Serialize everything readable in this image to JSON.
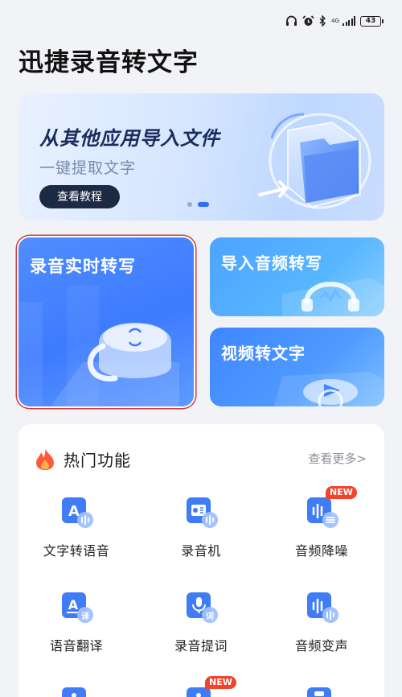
{
  "status": {
    "headphones_icon": "headphones-icon",
    "alarm_icon": "alarm-icon",
    "bluetooth_icon": "bluetooth-icon",
    "network": "4G",
    "battery": "43"
  },
  "app": {
    "title": "迅捷录音转文字"
  },
  "banner": {
    "title": "从其他应用导入文件",
    "subtitle": "一键提取文字",
    "button": "查看教程",
    "slides": 2,
    "active_slide": 2
  },
  "features": {
    "realtime": "录音实时转写",
    "import_audio": "导入音频转写",
    "video_to_text": "视频转文字"
  },
  "hot": {
    "title": "热门功能",
    "more": "查看更多>",
    "tools": [
      {
        "label": "文字转语音",
        "icon": "text-to-speech-icon",
        "icon_text": "A",
        "badge": ""
      },
      {
        "label": "录音机",
        "icon": "recorder-icon",
        "icon_text": "",
        "badge": ""
      },
      {
        "label": "音频降噪",
        "icon": "audio-denoise-icon",
        "icon_text": "",
        "badge": "NEW"
      },
      {
        "label": "语音翻译",
        "icon": "voice-translate-icon",
        "icon_text": "A",
        "badge_char": "译",
        "badge": ""
      },
      {
        "label": "录音提词",
        "icon": "teleprompter-icon",
        "icon_text": "",
        "badge_char": "词",
        "badge": ""
      },
      {
        "label": "音频变声",
        "icon": "voice-changer-icon",
        "icon_text": "",
        "badge": ""
      }
    ],
    "row3_badge": "NEW"
  },
  "colors": {
    "accent": "#2f6df6",
    "badge": "#f0442c",
    "dark_button": "#1d2a44"
  }
}
